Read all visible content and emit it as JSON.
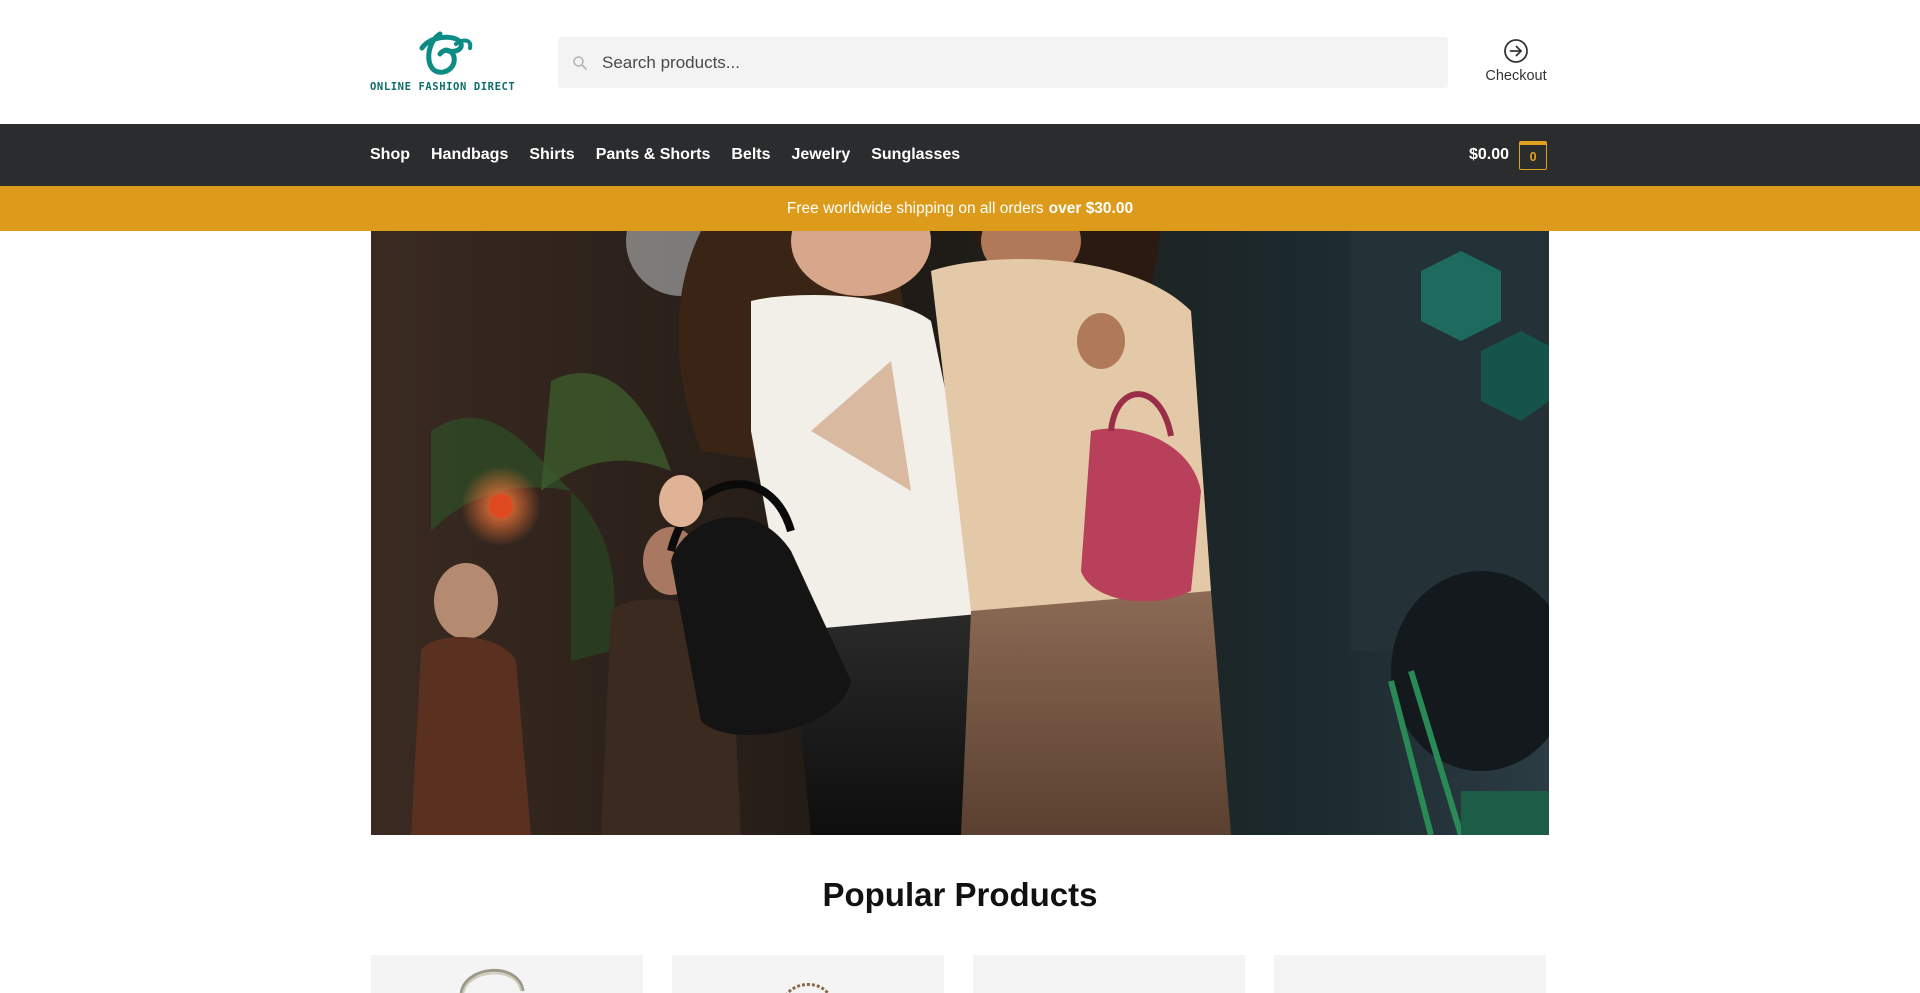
{
  "header": {
    "logo_text": "ONLINE FASHION DIRECT",
    "search": {
      "placeholder": "Search products...",
      "icon": "search-icon"
    },
    "checkout": {
      "label": "Checkout",
      "icon": "arrow-circle-right-icon"
    }
  },
  "nav": {
    "items": [
      {
        "label": "Shop"
      },
      {
        "label": "Handbags"
      },
      {
        "label": "Shirts"
      },
      {
        "label": "Pants & Shorts"
      },
      {
        "label": "Belts"
      },
      {
        "label": "Jewelry"
      },
      {
        "label": "Sunglasses"
      }
    ],
    "cart": {
      "amount": "$0.00",
      "count": "0"
    }
  },
  "promo": {
    "text": "Free worldwide shipping on all orders",
    "highlight": "over $30.00"
  },
  "main": {
    "section_title": "Popular Products"
  },
  "colors": {
    "brand_teal": "#0c8c84",
    "nav_bg": "#2b2c2d",
    "promo_bg": "#dd9b1c",
    "accent": "#e2a11e"
  }
}
